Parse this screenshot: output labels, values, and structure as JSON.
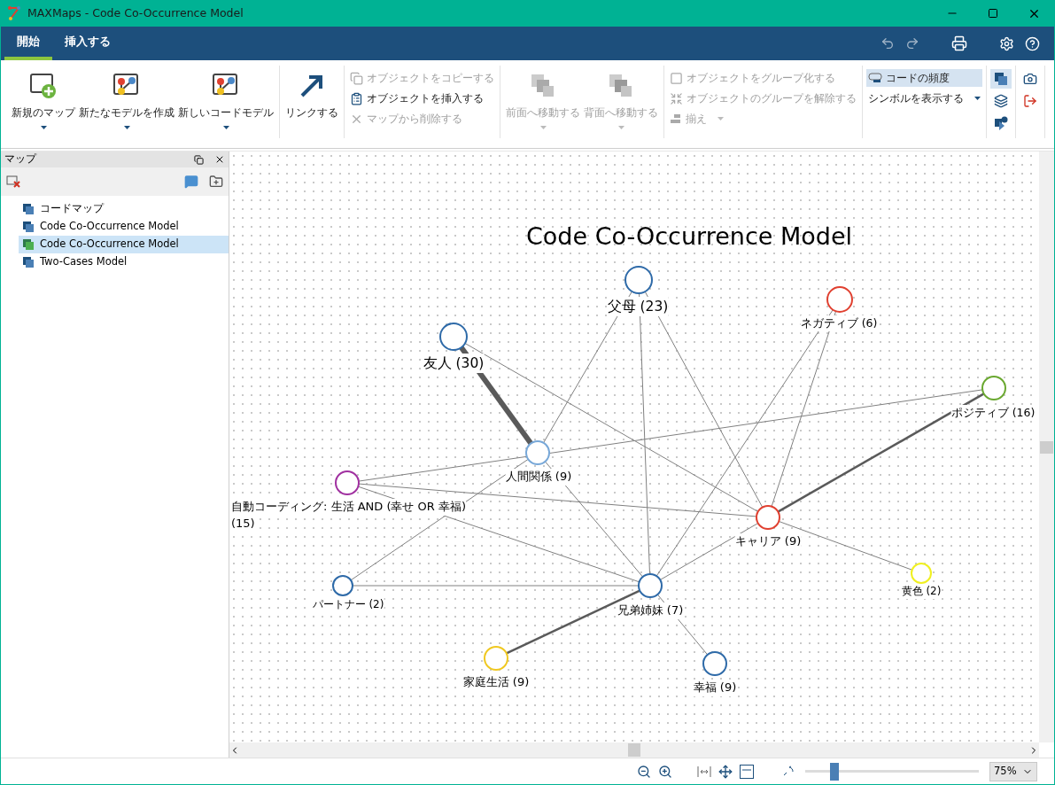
{
  "window": {
    "title": "MAXMaps - Code Co-Occurrence Model"
  },
  "menu_tabs": [
    {
      "label": "開始",
      "selected": true
    },
    {
      "label": "挿入する",
      "selected": false
    }
  ],
  "ribbon": {
    "groups": [
      {
        "items": [
          {
            "kind": "large",
            "label": "新規のマップ",
            "dropdown": true,
            "disabled": false
          },
          {
            "kind": "large",
            "label": "新たなモデルを作成",
            "dropdown": true,
            "disabled": false
          },
          {
            "kind": "large",
            "label": "新しいコードモデル",
            "dropdown": true,
            "disabled": false
          }
        ]
      },
      {
        "items": [
          {
            "kind": "large",
            "label": "リンクする",
            "dropdown": false,
            "disabled": false
          }
        ]
      },
      {
        "items": [
          {
            "kind": "small",
            "label": "オブジェクトをコピーする",
            "dropdown": false,
            "disabled": true
          },
          {
            "kind": "small",
            "label": "オブジェクトを挿入する",
            "dropdown": false,
            "disabled": false
          },
          {
            "kind": "small",
            "label": "マップから削除する",
            "dropdown": false,
            "disabled": true
          }
        ]
      },
      {
        "items": [
          {
            "kind": "large",
            "label": "前面へ移動する",
            "dropdown": true,
            "disabled": true
          },
          {
            "kind": "large",
            "label": "背面へ移動する",
            "dropdown": true,
            "disabled": true
          }
        ]
      },
      {
        "items": [
          {
            "kind": "small",
            "label": "オブジェクトをグループ化する",
            "dropdown": false,
            "disabled": true
          },
          {
            "kind": "small",
            "label": "オブジェクトのグループを解除する",
            "dropdown": false,
            "disabled": true
          },
          {
            "kind": "small",
            "label": "揃え",
            "dropdown": true,
            "disabled": true
          }
        ]
      },
      {
        "items": [
          {
            "kind": "small",
            "label": "コードの頻度",
            "dropdown": false,
            "disabled": false,
            "selected": true
          },
          {
            "kind": "small",
            "label": "シンボルを表示する",
            "dropdown": true,
            "disabled": false,
            "selected": false
          }
        ]
      },
      {
        "items": [
          {
            "kind": "icon",
            "selected": true
          },
          {
            "kind": "icon",
            "selected": false
          },
          {
            "kind": "icon",
            "selected": false
          }
        ]
      },
      {
        "items": [
          {
            "kind": "icon",
            "selected": false
          },
          {
            "kind": "icon",
            "selected": false
          }
        ]
      }
    ]
  },
  "panel": {
    "title": "マップ",
    "items": [
      {
        "label": "コードマップ",
        "selected": false
      },
      {
        "label": "Code Co-Occurrence Model",
        "selected": false
      },
      {
        "label": "Code Co-Occurrence Model",
        "selected": true
      },
      {
        "label": "Two-Cases Model",
        "selected": false
      }
    ]
  },
  "map": {
    "title": "Code Co-Occurrence Model",
    "nodes": [
      {
        "label_lines": [
          "父母 (23)"
        ],
        "color": "#2e6aa8"
      },
      {
        "label_lines": [
          "ネガティブ (6)"
        ],
        "color": "#e04030"
      },
      {
        "label_lines": [
          "友人 (30)"
        ],
        "color": "#2e6aa8"
      },
      {
        "label_lines": [
          "ポジティブ (16)"
        ],
        "color": "#6aa830"
      },
      {
        "label_lines": [
          "人間関係 (9)"
        ],
        "color": "#78a8d8"
      },
      {
        "label_lines": [
          "自動コーディング: 生活 AND (幸せ OR 幸福)",
          "(15)"
        ],
        "color": "#a030a0"
      },
      {
        "label_lines": [
          "キャリア (9)"
        ],
        "color": "#e04030"
      },
      {
        "label_lines": [
          "黄色 (2)"
        ],
        "color": "#f0f020"
      },
      {
        "label_lines": [
          "パートナー (2)"
        ],
        "color": "#2e6aa8"
      },
      {
        "label_lines": [
          "兄弟姉妹 (7)"
        ],
        "color": "#2e6aa8"
      },
      {
        "label_lines": [
          "家庭生活 (9)"
        ],
        "color": "#f0c820"
      },
      {
        "label_lines": [
          "幸福 (9)"
        ],
        "color": "#2e6aa8"
      }
    ]
  },
  "zoom": {
    "level": 0.15,
    "value": "75%"
  }
}
